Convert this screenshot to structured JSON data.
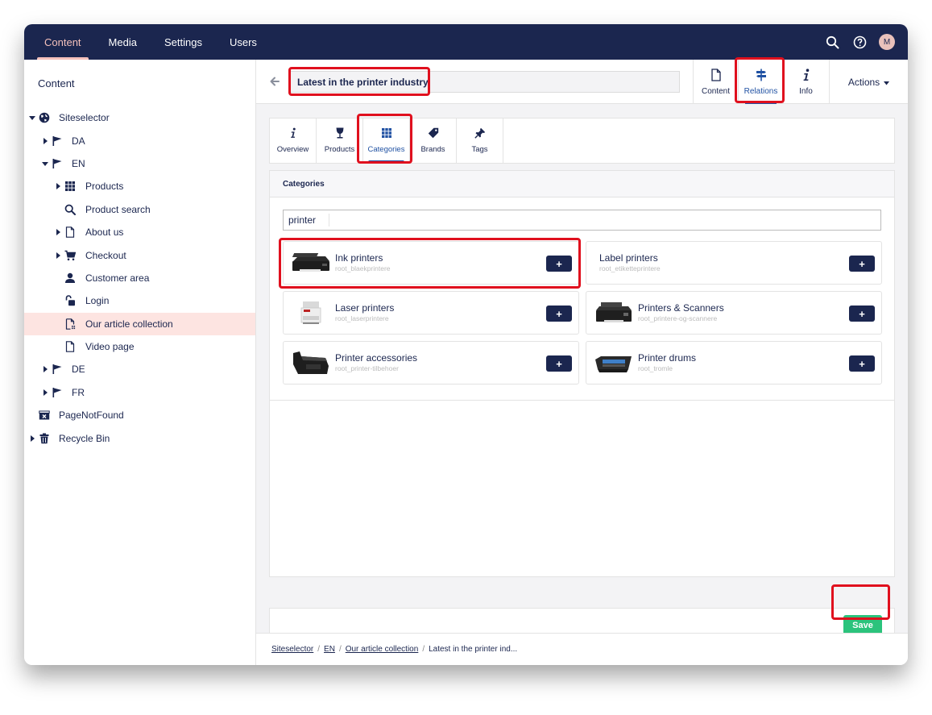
{
  "topbar": {
    "sections": [
      "Content",
      "Media",
      "Settings",
      "Users"
    ],
    "active_section": "Content",
    "avatar_initial": "M",
    "icons": [
      "search-icon",
      "help-icon",
      "avatar"
    ]
  },
  "sidebar": {
    "title": "Content",
    "tree": [
      {
        "label": "Siteselector",
        "icon": "globe-icon"
      },
      {
        "label": "DA",
        "icon": "flag-icon"
      },
      {
        "label": "EN",
        "icon": "flag-icon"
      },
      {
        "label": "Products",
        "icon": "grid-icon"
      },
      {
        "label": "Product search",
        "icon": "search-icon"
      },
      {
        "label": "About us",
        "icon": "document-icon"
      },
      {
        "label": "Checkout",
        "icon": "cart-icon"
      },
      {
        "label": "Customer area",
        "icon": "user-icon"
      },
      {
        "label": "Login",
        "icon": "unlock-icon"
      },
      {
        "label": "Our article collection",
        "icon": "document-list-icon"
      },
      {
        "label": "Video page",
        "icon": "document-icon"
      },
      {
        "label": "DE",
        "icon": "flag-icon"
      },
      {
        "label": "FR",
        "icon": "flag-icon"
      },
      {
        "label": "PageNotFound",
        "icon": "not-found-icon"
      },
      {
        "label": "Recycle Bin",
        "icon": "trash-icon"
      }
    ]
  },
  "editor": {
    "title_value": "Latest in the printer industry",
    "apps": [
      {
        "label": "Content",
        "icon": "document-icon"
      },
      {
        "label": "Relations",
        "icon": "signpost-icon"
      },
      {
        "label": "Info",
        "icon": "info-icon"
      }
    ],
    "active_app": "Relations",
    "actions_label": "Actions"
  },
  "tabs": [
    {
      "label": "Overview",
      "icon": "info-icon"
    },
    {
      "label": "Products",
      "icon": "glass-icon"
    },
    {
      "label": "Categories",
      "icon": "grid-icon"
    },
    {
      "label": "Brands",
      "icon": "tag-icon"
    },
    {
      "label": "Tags",
      "icon": "pin-icon"
    }
  ],
  "active_tab": "Categories",
  "categories": {
    "header": "Categories",
    "search_value": "printer",
    "add_label": "+",
    "items": [
      {
        "name": "Ink printers",
        "path": "root_blaekprintere",
        "thumb": "ink-printer-thumb"
      },
      {
        "name": "Label printers",
        "path": "root_etiketteprintere",
        "thumb": ""
      },
      {
        "name": "Laser printers",
        "path": "root_laserprintere",
        "thumb": "laser-printer-thumb"
      },
      {
        "name": "Printers & Scanners",
        "path": "root_printere-og-scannere",
        "thumb": "printer-scanner-thumb"
      },
      {
        "name": "Printer accessories",
        "path": "root_printer-tilbehoer",
        "thumb": "toner-thumb"
      },
      {
        "name": "Printer drums",
        "path": "root_tromle",
        "thumb": "drum-thumb"
      }
    ]
  },
  "save_label": "Save",
  "breadcrumb": [
    "Siteselector",
    "EN",
    "Our article collection",
    "Latest in the printer ind..."
  ],
  "colors": {
    "navbar": "#1b264f",
    "accent": "#2152a3",
    "selected_row": "#fde4e1",
    "save": "#2bc37c",
    "highlight": "#e0101e"
  }
}
